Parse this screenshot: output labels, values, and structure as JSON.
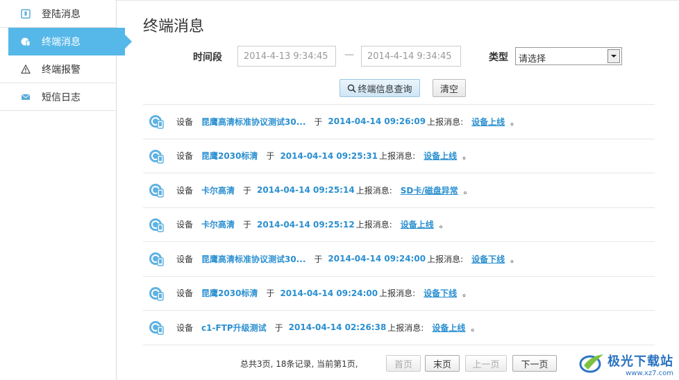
{
  "sidebar": {
    "items": [
      {
        "label": "登陆消息",
        "icon": "login-icon",
        "active": false
      },
      {
        "label": "终端消息",
        "icon": "terminal-message-icon",
        "active": true
      },
      {
        "label": "终端报警",
        "icon": "warning-icon",
        "active": false
      },
      {
        "label": "短信日志",
        "icon": "mail-icon",
        "active": false
      }
    ]
  },
  "main": {
    "title": "终端消息",
    "filter": {
      "period_label": "时间段",
      "start_value": "2014-4-13 9:34:45",
      "dash": "—",
      "end_value": "2014-4-14 9:34:45",
      "type_label": "类型",
      "type_selected": "请选择"
    },
    "buttons": {
      "query_label": "终端信息查询",
      "clear_label": "清空"
    },
    "row_words": {
      "device": "设备",
      "at": "于",
      "report": "上报消息:",
      "period": "。"
    },
    "messages": [
      {
        "device": "昆鹰高清标准协议测试30...",
        "time": "2014-04-14 09:26:09",
        "message": "设备上线"
      },
      {
        "device": "昆鹰2030标清",
        "time": "2014-04-14 09:25:31",
        "message": "设备上线"
      },
      {
        "device": "卡尔高清",
        "time": "2014-04-14 09:25:14",
        "message": "SD卡/磁盘异常"
      },
      {
        "device": "卡尔高清",
        "time": "2014-04-14 09:25:12",
        "message": "设备上线"
      },
      {
        "device": "昆鹰高清标准协议测试30...",
        "time": "2014-04-14 09:24:00",
        "message": "设备下线"
      },
      {
        "device": "昆鹰2030标清",
        "time": "2014-04-14 09:24:00",
        "message": "设备下线"
      },
      {
        "device": "c1-FTP升级测试",
        "time": "2014-04-14 02:26:38",
        "message": "设备上线"
      }
    ],
    "pager": {
      "info": "总共3页, 18条记录, 当前第1页,",
      "first": "首页",
      "last": "末页",
      "prev": "上一页",
      "next": "下一页"
    }
  },
  "watermark": {
    "brand": "极光下载站",
    "url": "www.xz7.com"
  },
  "colors": {
    "accent": "#56b8e8",
    "link": "#2a8fd0"
  }
}
